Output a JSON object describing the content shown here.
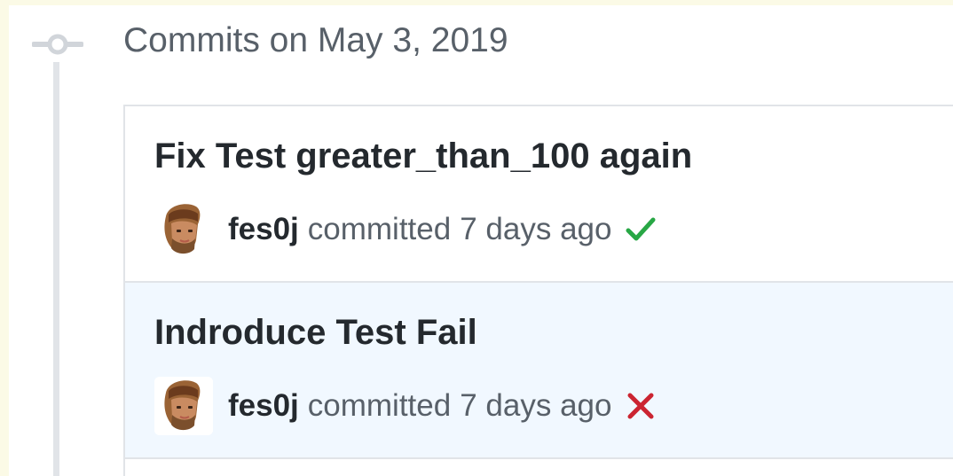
{
  "history": {
    "date_heading": "Commits on May 3, 2019",
    "commits": [
      {
        "title": "Fix Test greater_than_100 again",
        "author": "fes0j",
        "action": "committed",
        "time": "7 days ago",
        "status_icon": "check-icon",
        "status_color": "#28a745"
      },
      {
        "title": "Indroduce Test Fail",
        "author": "fes0j",
        "action": "committed",
        "time": "7 days ago",
        "status_icon": "x-icon",
        "status_color": "#cb2431"
      }
    ]
  },
  "colors": {
    "page_background": "#fbfae6",
    "highlight_row": "#f1f8ff",
    "border": "#e1e4e8",
    "text_primary": "#24292e",
    "text_secondary": "#586069"
  }
}
